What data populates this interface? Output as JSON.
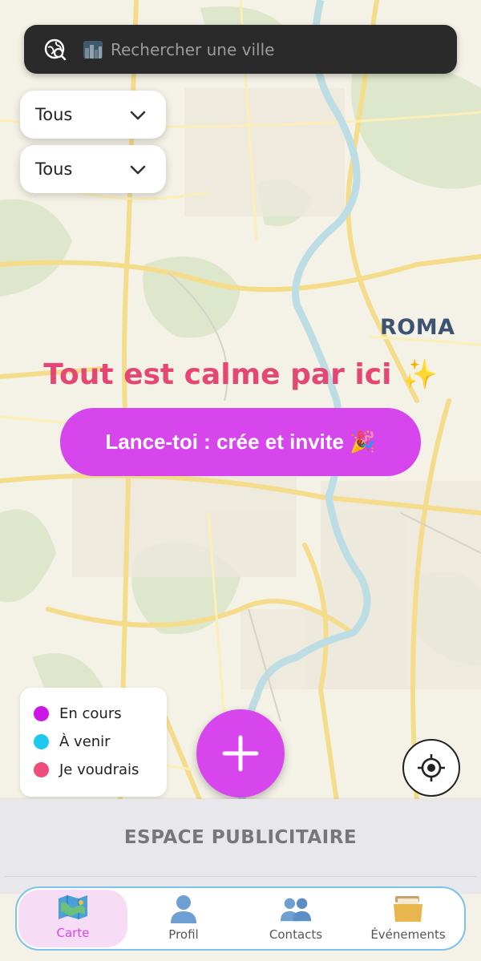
{
  "search": {
    "placeholder": "Rechercher une ville"
  },
  "filters": [
    {
      "selected": "Tous"
    },
    {
      "selected": "Tous"
    }
  ],
  "map": {
    "city_label": "ROMA"
  },
  "empty_state": {
    "title": "Tout est calme par ici ✨",
    "cta_label": "Lance-toi : crée et invite 🎉"
  },
  "legend": [
    {
      "label": "En cours",
      "color": "#cc16e6"
    },
    {
      "label": "À venir",
      "color": "#1fc8ee"
    },
    {
      "label": "Je voudrais",
      "color": "#ec4d7a"
    }
  ],
  "ad": {
    "label": "ESPACE PUBLICITAIRE"
  },
  "nav": [
    {
      "label": "Carte",
      "icon": "map-icon"
    },
    {
      "label": "Profil",
      "icon": "person-icon"
    },
    {
      "label": "Contacts",
      "icon": "people-icon"
    },
    {
      "label": "Événements",
      "icon": "folder-icon"
    }
  ],
  "colors": {
    "accent": "#d646ec",
    "title": "#e54775"
  }
}
